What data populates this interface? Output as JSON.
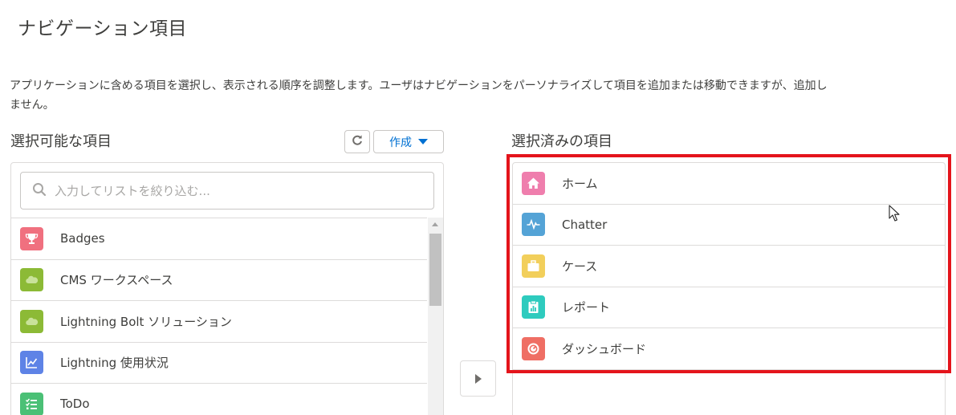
{
  "page": {
    "title": "ナビゲーション項目",
    "description": "アプリケーションに含める項目を選択し、表示される順序を調整します。ユーザはナビゲーションをパーソナライズして項目を追加または移動できますが、追加し\nません。"
  },
  "available": {
    "heading": "選択可能な項目",
    "refresh_icon": "refresh-icon",
    "create_label": "作成",
    "search_placeholder": "入力してリストを絞り込む...",
    "items": [
      {
        "label": "Badges",
        "icon": "trophy-icon",
        "color": "#f0707f"
      },
      {
        "label": "CMS ワークスペース",
        "icon": "salesforce-cloud-icon",
        "color": "#8cba36"
      },
      {
        "label": "Lightning Bolt ソリューション",
        "icon": "salesforce-cloud-icon",
        "color": "#8cba36"
      },
      {
        "label": "Lightning 使用状況",
        "icon": "line-chart-icon",
        "color": "#5e83e6"
      },
      {
        "label": "ToDo",
        "icon": "task-list-icon",
        "color": "#4bc076"
      }
    ]
  },
  "selected": {
    "heading": "選択済みの項目",
    "items": [
      {
        "label": "ホーム",
        "icon": "home-icon",
        "color": "#ef7ead"
      },
      {
        "label": "Chatter",
        "icon": "chatter-pulse-icon",
        "color": "#54a3d6"
      },
      {
        "label": "ケース",
        "icon": "briefcase-icon",
        "color": "#f2cf5b"
      },
      {
        "label": "レポート",
        "icon": "report-icon",
        "color": "#2ecbbe"
      },
      {
        "label": "ダッシュボード",
        "icon": "dashboard-gauge-icon",
        "color": "#ef6e64"
      }
    ]
  },
  "colors": {
    "accent": "#0070d2",
    "highlight": "#e4141b",
    "border": "#dddbda"
  }
}
